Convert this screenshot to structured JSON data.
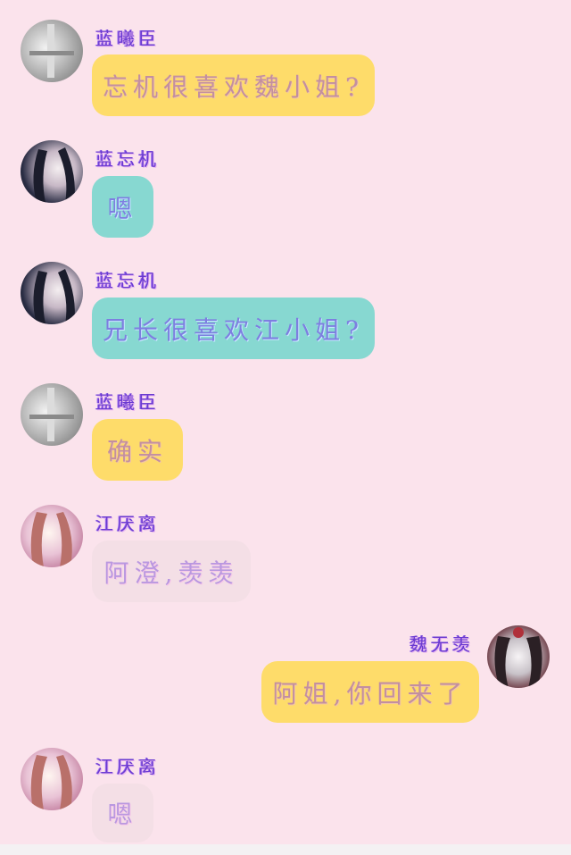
{
  "messages": [
    {
      "sender": "蓝曦臣",
      "text": "忘机很喜欢魏小姐?",
      "bubble": "yellow",
      "avatar": "avatar-gray",
      "side": "left"
    },
    {
      "sender": "蓝忘机",
      "text": "嗯",
      "bubble": "teal",
      "avatar": "avatar-dark",
      "side": "left"
    },
    {
      "sender": "蓝忘机",
      "text": "兄长很喜欢江小姐?",
      "bubble": "teal",
      "avatar": "avatar-dark",
      "side": "left"
    },
    {
      "sender": "蓝曦臣",
      "text": "确实",
      "bubble": "yellow",
      "avatar": "avatar-gray",
      "side": "left"
    },
    {
      "sender": "江厌离",
      "text": "阿澄,羡羡",
      "bubble": "lite",
      "avatar": "avatar-pink",
      "side": "left"
    },
    {
      "sender": "魏无羡",
      "text": "阿姐,你回来了",
      "bubble": "yellow",
      "avatar": "avatar-dual",
      "side": "right"
    },
    {
      "sender": "江厌离",
      "text": "嗯",
      "bubble": "lite",
      "avatar": "avatar-pink",
      "side": "left"
    }
  ],
  "colors": {
    "background": "#fbe3ec",
    "bubble_yellow": "#fedc6a",
    "bubble_teal": "#87d8d1",
    "bubble_light": "#f4dfe6",
    "name_purple": "#6a3bd0"
  }
}
